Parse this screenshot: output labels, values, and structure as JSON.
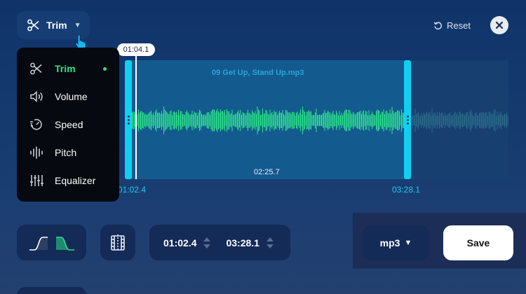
{
  "toolbar": {
    "tool_label": "Trim",
    "reset_label": "Reset"
  },
  "menu": {
    "items": [
      {
        "label": "Trim",
        "icon": "scissors-icon",
        "active": true
      },
      {
        "label": "Volume",
        "icon": "speaker-icon",
        "active": false
      },
      {
        "label": "Speed",
        "icon": "speedometer-icon",
        "active": false
      },
      {
        "label": "Pitch",
        "icon": "pitch-icon",
        "active": false
      },
      {
        "label": "Equalizer",
        "icon": "equalizer-icon",
        "active": false
      }
    ]
  },
  "track": {
    "filename": "09 Get Up, Stand Up.mp3",
    "playhead_time": "01:04.1",
    "selection_duration": "02:25.7",
    "start_marker": "01:02.4",
    "end_marker": "03:28.1"
  },
  "controls": {
    "start_time": "01:02.4",
    "end_time": "03:28.1",
    "format": "mp3",
    "save_label": "Save"
  },
  "colors": {
    "accent_green": "#33e088",
    "handle_cyan": "#0fd0f2",
    "waveform_active": "#2ee88c",
    "waveform_inactive": "#2a6b8a"
  }
}
